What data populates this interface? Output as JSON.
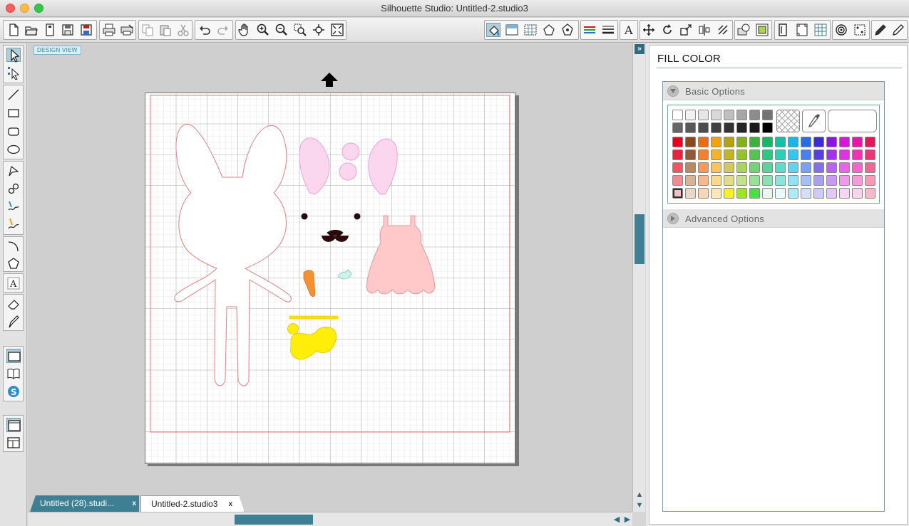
{
  "window": {
    "title": "Silhouette Studio: Untitled-2.studio3"
  },
  "toolbar": {
    "file_icons": [
      "new-document-icon",
      "open-folder-icon",
      "open-file-icon",
      "save-icon",
      "save-library-icon",
      "print-icon",
      "print-cut-icon"
    ],
    "edit_icons": [
      "copy-icon",
      "paste-icon",
      "cut-icon",
      "undo-icon",
      "redo-icon"
    ],
    "view_icons": [
      "pan-hand-icon",
      "zoom-in-icon",
      "zoom-out-icon",
      "zoom-select-icon",
      "zoom-drag-icon",
      "zoom-fit-icon"
    ]
  },
  "canvas": {
    "design_view_label": "DESIGN VIEW",
    "accent": "#3e7f93",
    "cut_line_color": "#e46a6a",
    "shapes": {
      "bunny_outline": "#ffffff",
      "ear_pink": "#fbd6ef",
      "dress_pink": "#ffc9c9",
      "carrot_orange": "#f7912f",
      "bow_yellow": "#ffee0a",
      "eye_black": "#2a0a0a"
    }
  },
  "tabs": [
    {
      "label": "Untitled (28).studi...",
      "close": "x"
    },
    {
      "label": "Untitled-2.studio3",
      "close": "x"
    }
  ],
  "panel": {
    "title": "FILL COLOR",
    "basic_options": "Basic Options",
    "advanced_options": "Advanced Options",
    "swatch_rows": [
      [
        "#ffffff",
        "#f2f2f2",
        "#e6e6e6",
        "#d9d9d9",
        "#bfbfbf",
        "#a6a6a6",
        "#8c8c8c",
        "#737373"
      ],
      [
        "#666666",
        "#595959",
        "#4d4d4d",
        "#404040",
        "#333333",
        "#262626",
        "#1a1a1a",
        "#000000"
      ],
      [
        "#e8001c",
        "#8b4a1e",
        "#f26a10",
        "#f5a30c",
        "#b3a40c",
        "#7fb31c",
        "#3cb43c",
        "#12b868",
        "#0ec3a6",
        "#14b8e6",
        "#2b6ae8",
        "#3b2bd8",
        "#8f12e6",
        "#d815d8",
        "#e815a6",
        "#e8155a"
      ],
      [
        "#e8223a",
        "#8f5a34",
        "#f57f2a",
        "#f7b22a",
        "#c4b42a",
        "#95c42a",
        "#52c452",
        "#2ac880",
        "#2ad0b4",
        "#35c8ee",
        "#4a80ee",
        "#5540e0",
        "#a330ee",
        "#e032e0",
        "#ee34b4",
        "#ee3474"
      ],
      [
        "#ee5462",
        "#b88a64",
        "#f7995a",
        "#f9c55a",
        "#d4c85a",
        "#abd45a",
        "#72d472",
        "#5ad498",
        "#5adcc8",
        "#62d4f2",
        "#7aa0f2",
        "#8270ea",
        "#b864f2",
        "#e864e8",
        "#f266c8",
        "#f26694"
      ],
      [
        "#f28a90",
        "#d6b494",
        "#f9b88a",
        "#fbd88a",
        "#e2dc8a",
        "#c4e28a",
        "#98e298",
        "#8ae2b4",
        "#8ae6da",
        "#92e2f6",
        "#a4bef6",
        "#aaa0f0",
        "#cc98f6",
        "#f098ee",
        "#f69ad8",
        "#f69ab4"
      ],
      [
        "#f8c0c2",
        "#ead8c6",
        "#fcd4b8",
        "#fde8b8",
        "#f8f020",
        "#9ce61e",
        "#40e63e",
        "#e8f8f0",
        "#e8fafa",
        "#a4eef8",
        "#d4e0fa",
        "#d0caf6",
        "#e4c8fa",
        "#f8d4f6",
        "#fad4ec",
        "#f8b8cc"
      ]
    ],
    "selected_swatch": "6.0"
  }
}
